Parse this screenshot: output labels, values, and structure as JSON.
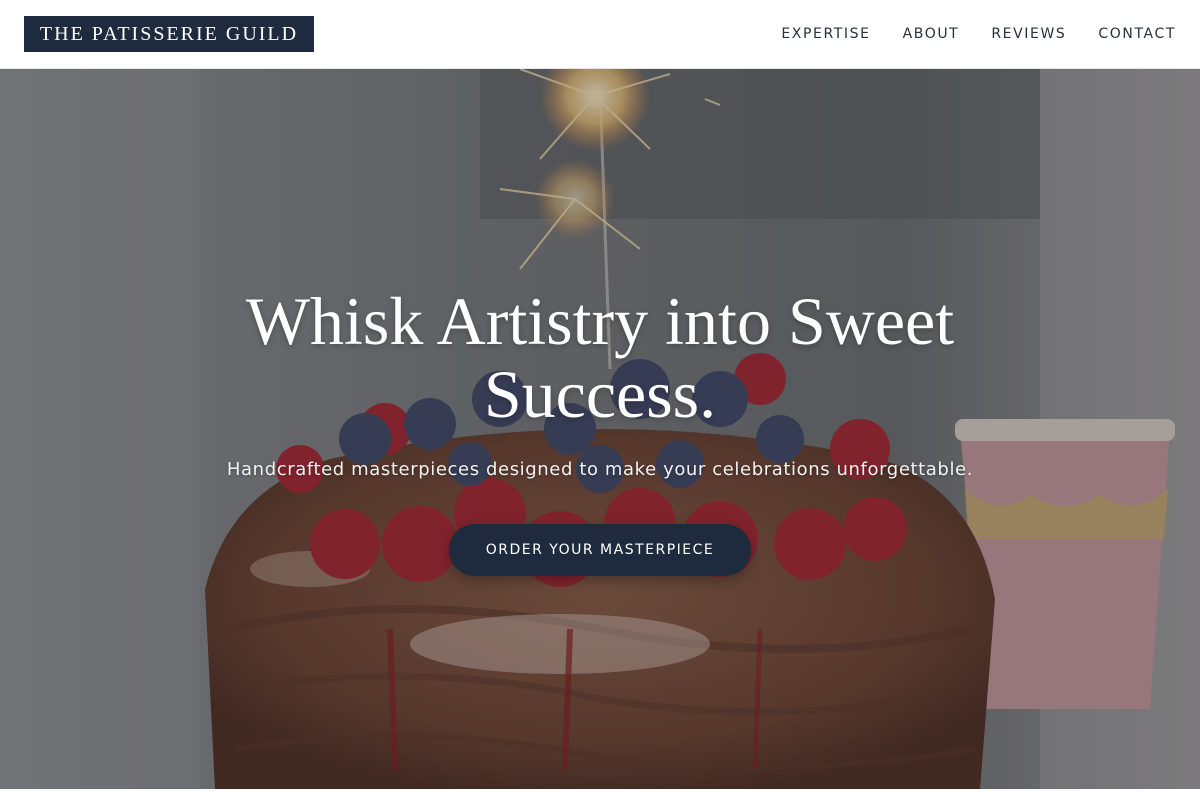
{
  "header": {
    "logo_text": "THE PATISSERIE GUILD",
    "nav": [
      {
        "label": "EXPERTISE"
      },
      {
        "label": "ABOUT"
      },
      {
        "label": "REVIEWS"
      },
      {
        "label": "CONTACT"
      }
    ]
  },
  "hero": {
    "headline": "Whisk Artistry into Sweet Success.",
    "subheadline": "Handcrafted masterpieces designed to make your celebrations unforgettable.",
    "cta_label": "ORDER YOUR MASTERPIECE",
    "background_image": "cake-with-sparkler"
  },
  "colors": {
    "brand_navy": "#1e2a3d",
    "header_bg": "#ffffff",
    "text_white": "#ffffff"
  }
}
